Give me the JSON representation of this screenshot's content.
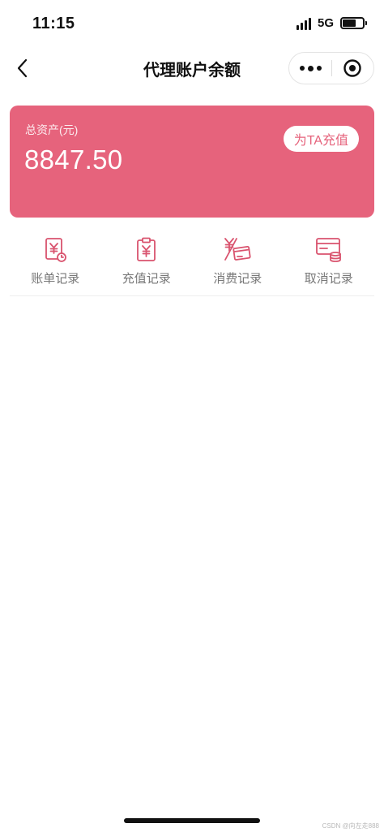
{
  "status_bar": {
    "time": "11:15",
    "network": "5G",
    "battery_level": 0.65
  },
  "nav": {
    "title": "代理账户余额",
    "back_icon": "chevron-left-icon",
    "more_icon": "more-dots-icon",
    "close_icon": "target-close-icon"
  },
  "asset_card": {
    "label": "总资产(元)",
    "value": "8847.50",
    "recharge_button": "为TA充值",
    "accent_color": "#e6637c"
  },
  "menu": {
    "icon_color": "#d9536e",
    "items": [
      {
        "label": "账单记录",
        "icon": "bill-record-icon"
      },
      {
        "label": "充值记录",
        "icon": "recharge-record-icon"
      },
      {
        "label": "消费记录",
        "icon": "consumption-record-icon"
      },
      {
        "label": "取消记录",
        "icon": "cancel-record-icon"
      }
    ]
  },
  "watermark": "CSDN @向左走888"
}
